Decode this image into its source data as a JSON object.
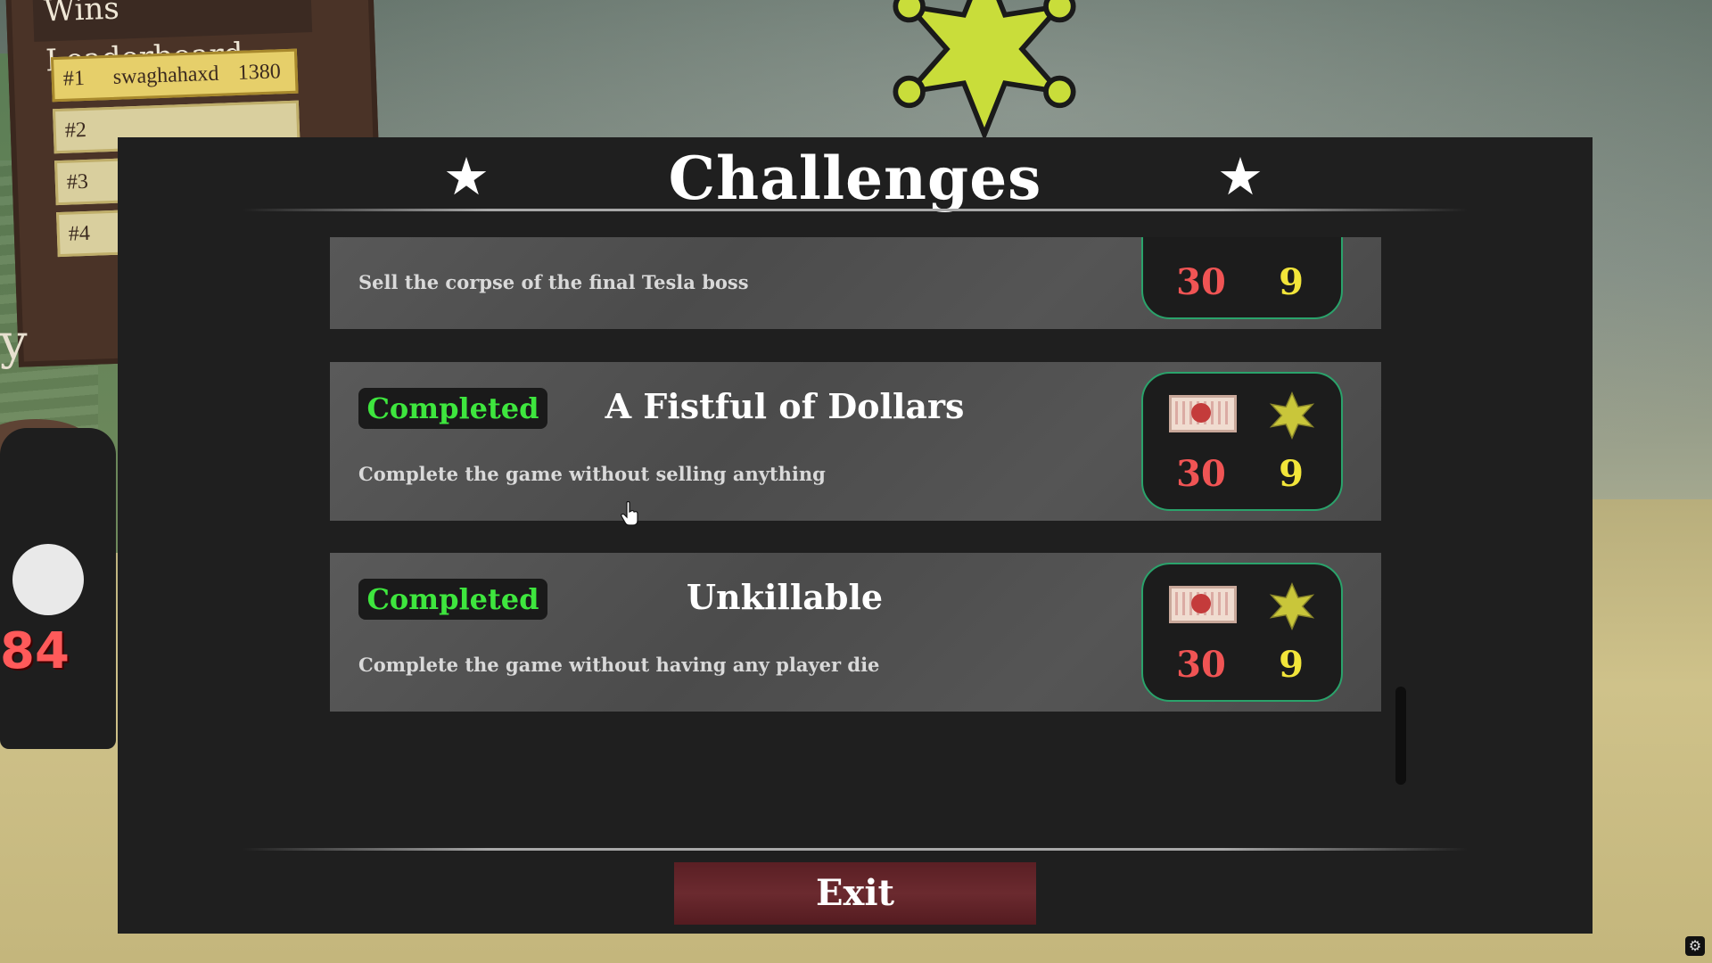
{
  "background": {
    "leaderboard": {
      "title": "Wins Leaderboard",
      "rows": [
        {
          "rank": "#1",
          "name": "swaghahaxd",
          "score": "1380"
        },
        {
          "rank": "#2",
          "name": "",
          "score": ""
        },
        {
          "rank": "#3",
          "name": "",
          "score": ""
        },
        {
          "rank": "#4",
          "name": "",
          "score": ""
        }
      ]
    },
    "side_text": "y",
    "overhead_number": "84"
  },
  "panel": {
    "title": "Challenges",
    "star_left": "★",
    "star_right": "★",
    "challenges": [
      {
        "status": "",
        "title": "",
        "description": "Sell the corpse of the final Tesla boss",
        "reward_money": "30",
        "reward_stars": "9"
      },
      {
        "status": "Completed",
        "title": "A Fistful of Dollars",
        "description": "Complete the game without selling anything",
        "reward_money": "30",
        "reward_stars": "9"
      },
      {
        "status": "Completed",
        "title": "Unkillable",
        "description": "Complete the game without having any player die",
        "reward_money": "30",
        "reward_stars": "9"
      }
    ],
    "exit_label": "Exit"
  },
  "colors": {
    "panel_bg": "#1f1f1f",
    "completed_green": "#3ee63e",
    "money_red": "#f05454",
    "star_yellow": "#f2e53a",
    "reward_border": "#2aa36b",
    "exit_bg": "#6b2a2f",
    "badge_yellow": "#c9dd3a"
  },
  "icons": {
    "corner": "settings-icon",
    "badge": "sheriff-badge-icon",
    "ticket": "ticket-icon"
  }
}
